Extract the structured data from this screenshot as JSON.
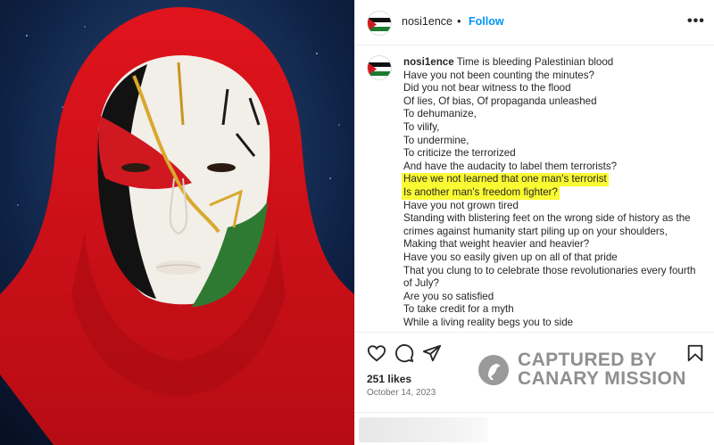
{
  "post": {
    "username": "nosi1ence",
    "follow_label": "Follow",
    "separator": "•",
    "more_label": "•••",
    "caption_first": "Time is bleeding Palestinian blood",
    "caption_lines": [
      "Have you not been counting the minutes?",
      "Did you not bear witness to the flood",
      "Of lies, Of bias, Of propaganda unleashed",
      "To dehumanize,",
      "To vilify,",
      "To undermine,",
      "To criticize the terrorized",
      "And have the audacity to label them terrorists?"
    ],
    "highlighted_lines": [
      "Have we not learned that one man's terrorist",
      "Is another man's freedom fighter?"
    ],
    "caption_lines_after": [
      "Have you not grown tired",
      "Standing with blistering feet on the wrong side of history as the",
      "crimes against humanity start piling up on your shoulders,",
      "Making that weight heavier and heavier?",
      "Have you so easily given up on all of that pride",
      "That you clung to to celebrate those revolutionaries every fourth",
      "of July?",
      "Are you so satisfied",
      "To take credit for a myth",
      "While a living reality begs you to side"
    ],
    "likes": "251 likes",
    "date": "October 14, 2023"
  },
  "watermark": {
    "line1": "CAPTURED BY",
    "line2": "CANARY MISSION"
  },
  "icons": {
    "like": "heart-icon",
    "comment": "comment-icon",
    "share": "send-icon",
    "save": "bookmark-icon",
    "more": "more-dots-icon"
  },
  "colors": {
    "follow_blue": "#0095f6",
    "highlight_yellow": "#fafa32",
    "hijab_red": "#d3131b",
    "date_gray": "#737373"
  }
}
